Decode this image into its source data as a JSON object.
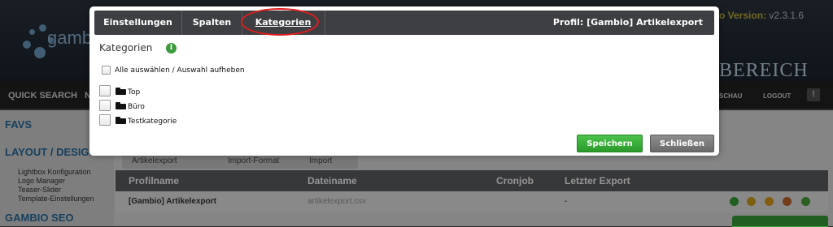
{
  "background": {
    "logo_text": "gamb",
    "version_label": "o Version:",
    "version_value": "v2.3.1.6",
    "area_title": "BEREICH",
    "nav": {
      "quick_search": "QUICK SEARCH",
      "partial": "N",
      "right_items": [
        "SCHAU",
        "LOGOUT"
      ]
    },
    "sidebar": {
      "favs": "FAVS",
      "layout": "LAYOUT / DESIG",
      "layout_items": [
        "Lightbox Konfiguration",
        "Logo Manager",
        "Teaser-Slider",
        "Template-Einstellungen"
      ],
      "seo": "GAMBIO SEO"
    },
    "tabs": [
      "Artikelexport",
      "Import-Format",
      "Import"
    ],
    "table": {
      "headers": [
        "Profilname",
        "Dateiname",
        "Cronjob",
        "Letzter Export"
      ],
      "rows": [
        {
          "profilname": "[Gambio] Artikelexport",
          "dateiname": "artikelexport.csv",
          "cronjob": "",
          "letzter_export": "-"
        }
      ]
    }
  },
  "modal": {
    "tabs": [
      {
        "label": "Einstellungen",
        "active": false
      },
      {
        "label": "Spalten",
        "active": false
      },
      {
        "label": "Kategorien",
        "active": true
      }
    ],
    "profile_label": "Profil: [Gambio] Artikelexport",
    "section_title": "Kategorien",
    "info_icon": "i",
    "select_all_label": "Alle auswählen / Auswahl aufheben",
    "categories": [
      {
        "label": "Top",
        "checked": false
      },
      {
        "label": "Büro",
        "checked": false
      },
      {
        "label": "Testkategorie",
        "checked": false
      }
    ],
    "buttons": {
      "save": "Speichern",
      "close": "Schließen"
    }
  },
  "colors": {
    "highlight_ring": "#e21b1b",
    "save_button": "#2a9a2a",
    "close_button": "#6a6a6a",
    "modal_bar": "#3e3f42",
    "info_icon": "#3b9b3b"
  }
}
